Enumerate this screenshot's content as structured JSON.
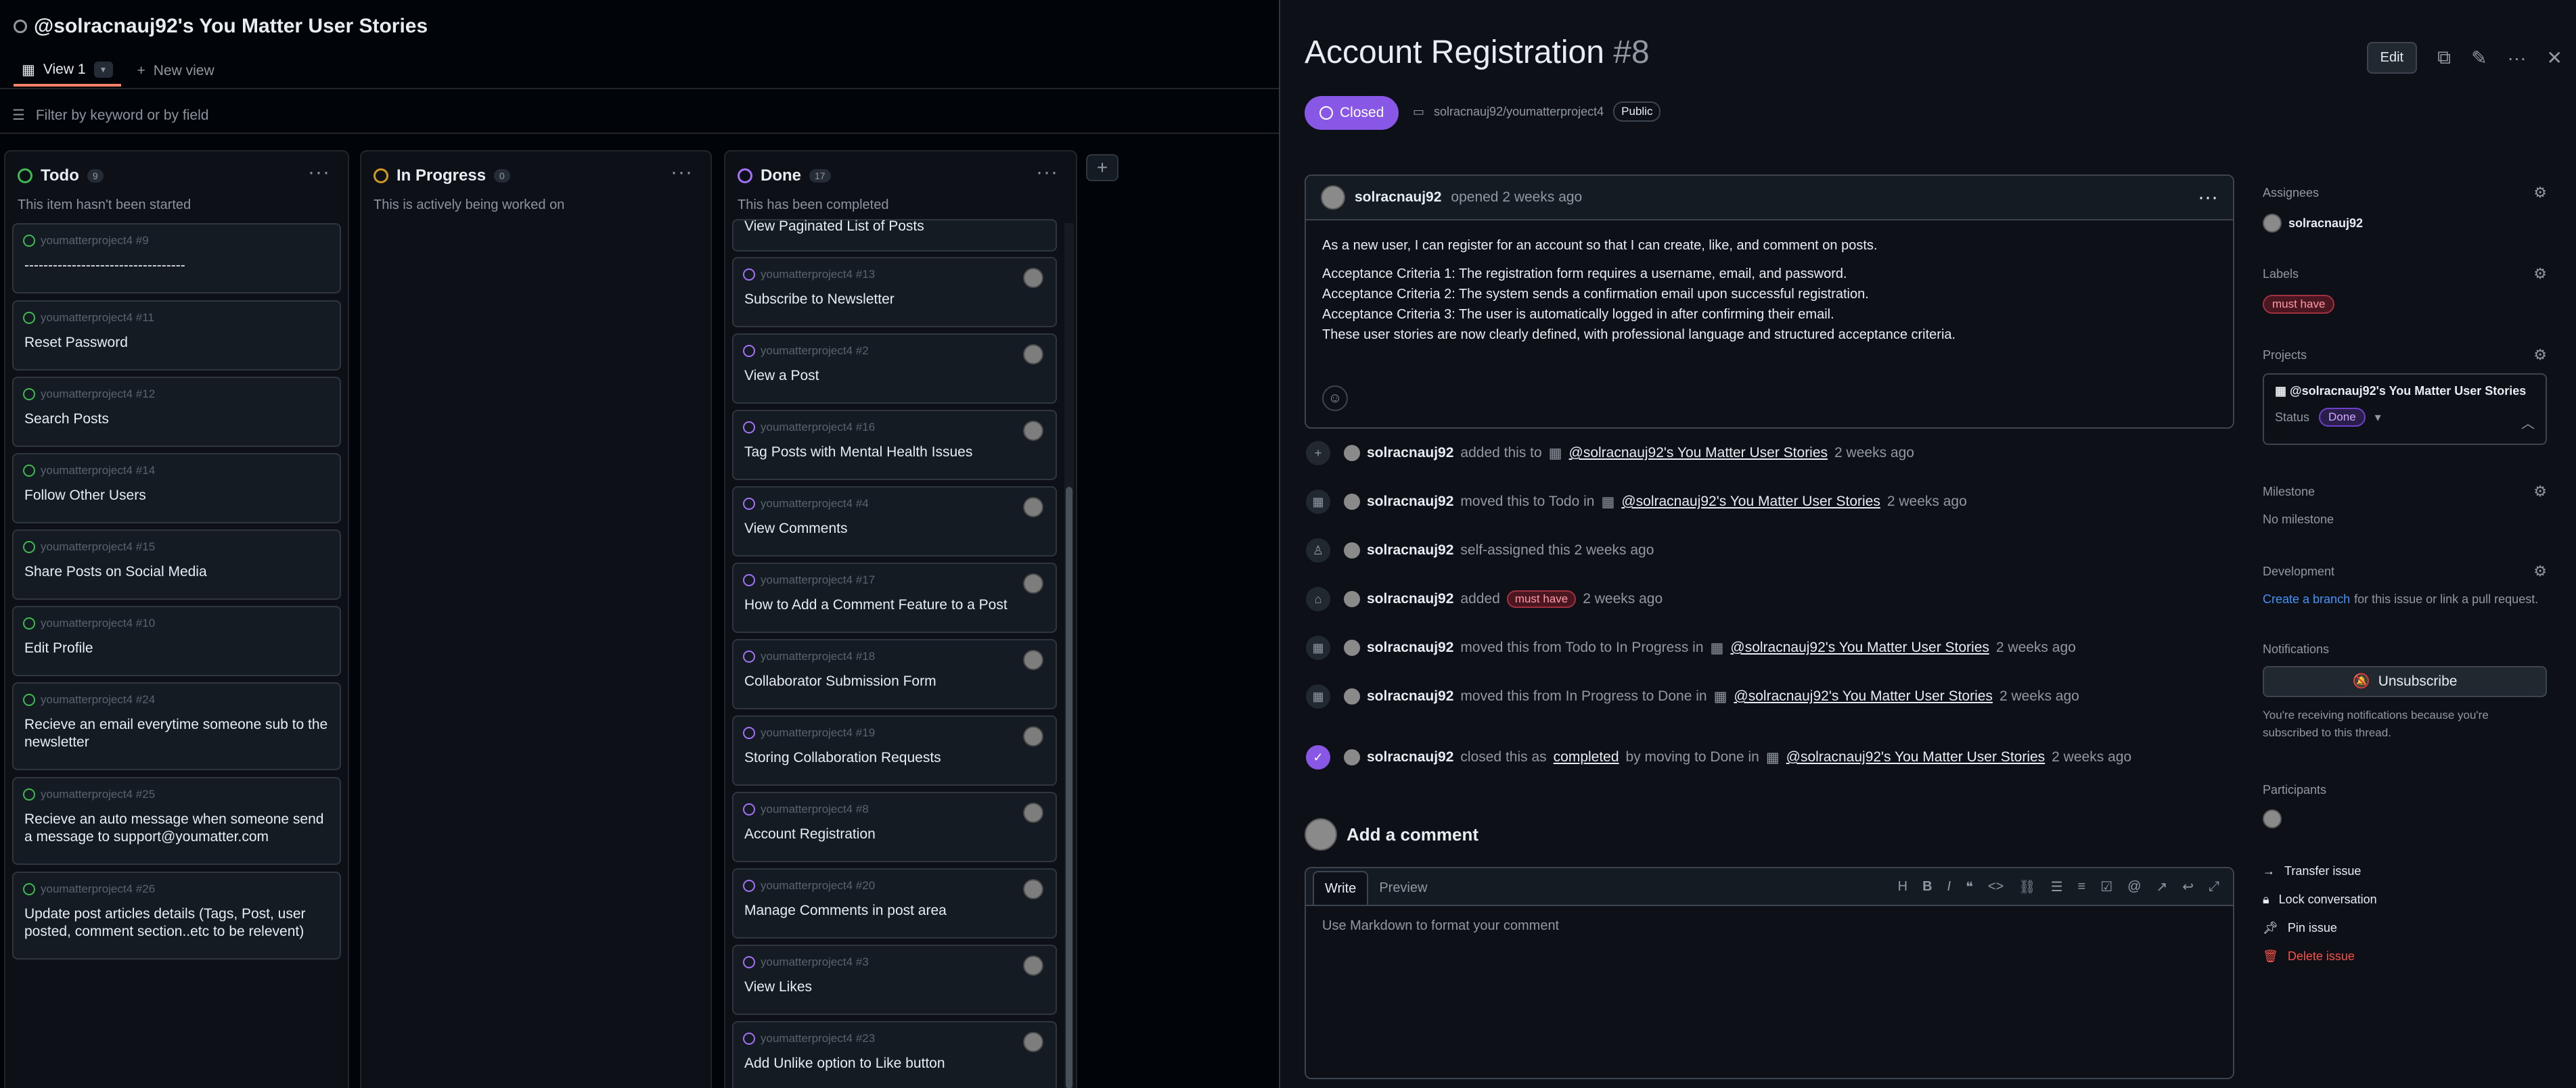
{
  "board": {
    "title": "@solracnauj92's You Matter User Stories",
    "view_tab": "View 1",
    "new_view": "New view",
    "filter_placeholder": "Filter by keyword or by field",
    "columns": [
      {
        "name": "Todo",
        "count": "9",
        "description": "This item hasn't been started",
        "color": "#3fb950",
        "cards": [
          {
            "meta": "youmatterproject4 #9",
            "title": "----------------------------------"
          },
          {
            "meta": "youmatterproject4 #11",
            "title": "Reset Password"
          },
          {
            "meta": "youmatterproject4 #12",
            "title": "Search Posts"
          },
          {
            "meta": "youmatterproject4 #14",
            "title": "Follow Other Users"
          },
          {
            "meta": "youmatterproject4 #15",
            "title": "Share Posts on Social Media"
          },
          {
            "meta": "youmatterproject4 #10",
            "title": "Edit Profile"
          },
          {
            "meta": "youmatterproject4 #24",
            "title": "Recieve an email everytime someone sub to the newsletter"
          },
          {
            "meta": "youmatterproject4 #25",
            "title": "Recieve an auto message when someone send a message to support@youmatter.com"
          },
          {
            "meta": "youmatterproject4 #26",
            "title": "Update post articles details (Tags, Post, user posted, comment section..etc to be relevent)"
          }
        ]
      },
      {
        "name": "In Progress",
        "count": "0",
        "description": "This is actively being worked on",
        "color": "#d29922",
        "cards": []
      },
      {
        "name": "Done",
        "count": "17",
        "description": "This has been completed",
        "color": "#a371f7",
        "cards": [
          {
            "meta": "",
            "title": "View Paginated List of Posts"
          },
          {
            "meta": "youmatterproject4 #13",
            "title": "Subscribe to Newsletter"
          },
          {
            "meta": "youmatterproject4 #2",
            "title": "View a Post"
          },
          {
            "meta": "youmatterproject4 #16",
            "title": "Tag Posts with Mental Health Issues"
          },
          {
            "meta": "youmatterproject4 #4",
            "title": "View Comments"
          },
          {
            "meta": "youmatterproject4 #17",
            "title": "How to Add a Comment Feature to a Post"
          },
          {
            "meta": "youmatterproject4 #18",
            "title": "Collaborator Submission Form"
          },
          {
            "meta": "youmatterproject4 #19",
            "title": "Storing Collaboration Requests"
          },
          {
            "meta": "youmatterproject4 #8",
            "title": "Account Registration"
          },
          {
            "meta": "youmatterproject4 #20",
            "title": "Manage Comments in post area"
          },
          {
            "meta": "youmatterproject4 #3",
            "title": "View Likes"
          },
          {
            "meta": "youmatterproject4 #23",
            "title": "Add Unlike option to Like button"
          }
        ]
      }
    ]
  },
  "issue": {
    "title": "Account Registration",
    "number": "#8",
    "edit_label": "Edit",
    "state": "Closed",
    "repo": "solracnauj92/youmatterproject4",
    "visibility": "Public",
    "author": "solracnauj92",
    "opened_text": "opened 2 weeks ago",
    "body": [
      "As a new user, I can register for an account so that I can create, like, and comment on posts.",
      "Acceptance Criteria 1: The registration form requires a username, email, and password.",
      "Acceptance Criteria 2: The system sends a confirmation email upon successful registration.",
      "Acceptance Criteria 3: The user is automatically logged in after confirming their email.",
      "These user stories are now clearly defined, with professional language and structured acceptance criteria."
    ],
    "events": [
      {
        "icon": "plus-icon",
        "user": "solracnauj92",
        "pre": "added this to",
        "link": "@solracnauj92's You Matter User Stories",
        "post": "2 weeks ago"
      },
      {
        "icon": "table-icon",
        "user": "solracnauj92",
        "pre": "moved this to Todo in",
        "link": "@solracnauj92's You Matter User Stories",
        "post": "2 weeks ago"
      },
      {
        "icon": "person-icon",
        "user": "solracnauj92",
        "pre": "self-assigned this 2 weeks ago",
        "link": "",
        "post": ""
      },
      {
        "icon": "tag-icon",
        "user": "solracnauj92",
        "pre": "added",
        "label": "must have",
        "post": "2 weeks ago"
      },
      {
        "icon": "table-icon",
        "user": "solracnauj92",
        "pre": "moved this from Todo to In Progress in",
        "link": "@solracnauj92's You Matter User Stories",
        "post": "2 weeks ago"
      },
      {
        "icon": "table-icon",
        "user": "solracnauj92",
        "pre": "moved this from In Progress to Done in",
        "link": "@solracnauj92's You Matter User Stories",
        "post": "2 weeks ago"
      },
      {
        "icon": "check-circle-icon",
        "user": "solracnauj92",
        "pre": "closed this as",
        "link0": "completed",
        "mid": "by moving to Done in",
        "link": "@solracnauj92's You Matter User Stories",
        "post": "2 weeks ago"
      }
    ],
    "add_comment": "Add a comment",
    "write_tab": "Write",
    "preview_tab": "Preview",
    "comment_placeholder": "Use Markdown to format your comment"
  },
  "sidebar": {
    "assignees_label": "Assignees",
    "assignee": "solracnauj92",
    "labels_label": "Labels",
    "label": "must have",
    "projects_label": "Projects",
    "project_name": "@solracnauj92's You Matter User Stories",
    "status_label": "Status",
    "status_value": "Done",
    "milestone_label": "Milestone",
    "milestone_value": "No milestone",
    "development_label": "Development",
    "dev_link": "Create a branch",
    "dev_text": "for this issue or link a pull request.",
    "notifications_label": "Notifications",
    "unsubscribe": "Unsubscribe",
    "notify_note": "You're receiving notifications because you're subscribed to this thread.",
    "participants_label": "Participants",
    "transfer": "Transfer issue",
    "lock": "Lock conversation",
    "pin": "Pin issue",
    "delete": "Delete issue"
  }
}
